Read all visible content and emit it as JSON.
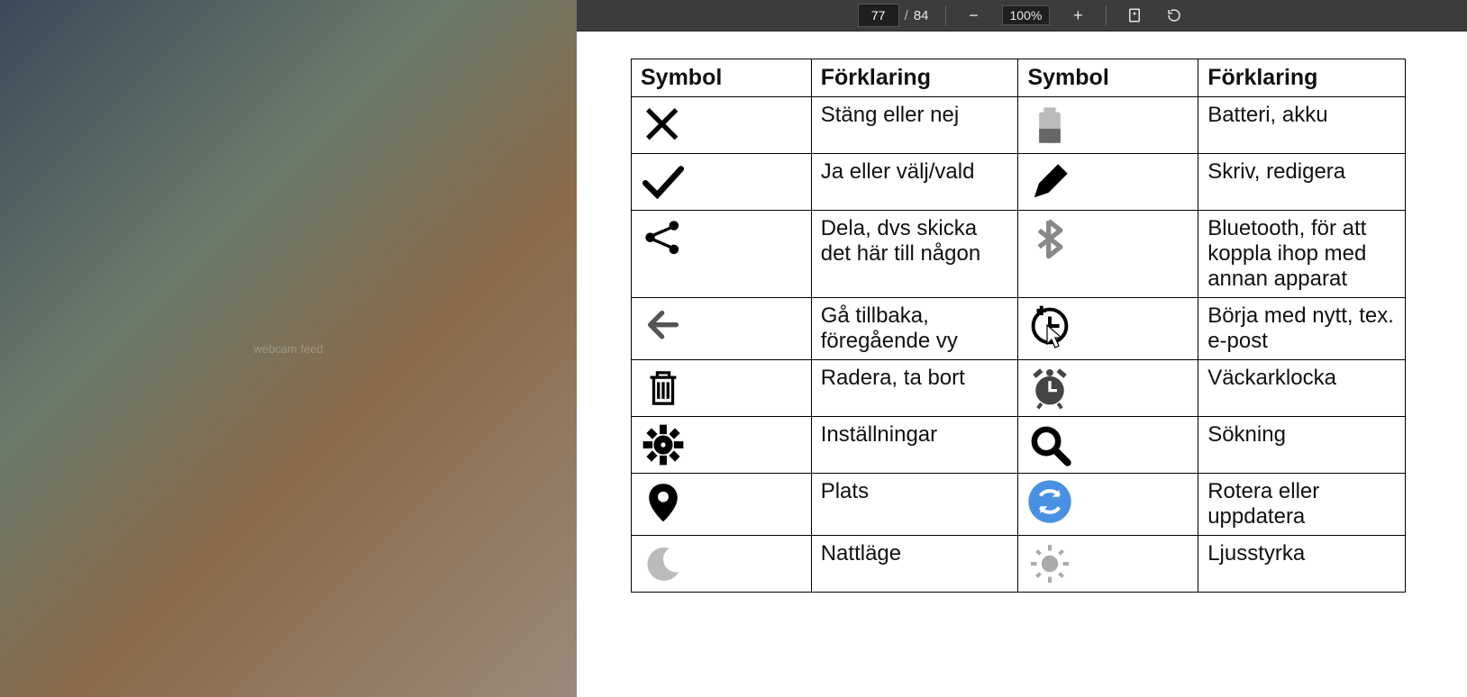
{
  "toolbar": {
    "page_current": "77",
    "page_total": "84",
    "zoom": "100%"
  },
  "headers": {
    "sym1": "Symbol",
    "exp1": "Förklaring",
    "sym2": "Symbol",
    "exp2": "Förklaring"
  },
  "rows": [
    {
      "icon1": "close-icon",
      "exp1": "Stäng eller nej",
      "icon2": "battery-icon",
      "exp2": "Batteri, akku"
    },
    {
      "icon1": "check-icon",
      "exp1": "Ja eller välj/vald",
      "icon2": "edit-icon",
      "exp2": "Skriv, redigera"
    },
    {
      "icon1": "share-icon",
      "exp1": "Dela, dvs skicka det här till någon",
      "icon2": "bluetooth-icon",
      "exp2": "Bluetooth, för att koppla ihop med annan apparat"
    },
    {
      "icon1": "back-icon",
      "exp1": "Gå tillbaka, föregående vy",
      "icon2": "clock-plus-icon",
      "exp2": "Börja med nytt, tex. e-post"
    },
    {
      "icon1": "trash-icon",
      "exp1": "Radera, ta bort",
      "icon2": "alarm-icon",
      "exp2": "Väckarklocka"
    },
    {
      "icon1": "gear-icon",
      "exp1": "Inställningar",
      "icon2": "search-icon",
      "exp2": "Sökning"
    },
    {
      "icon1": "location-icon",
      "exp1": "Plats",
      "icon2": "refresh-icon",
      "exp2": "Rotera eller uppdatera"
    },
    {
      "icon1": "night-icon",
      "exp1": "Nattläge",
      "icon2": "brightness-icon",
      "exp2": "Ljusstyrka"
    }
  ]
}
